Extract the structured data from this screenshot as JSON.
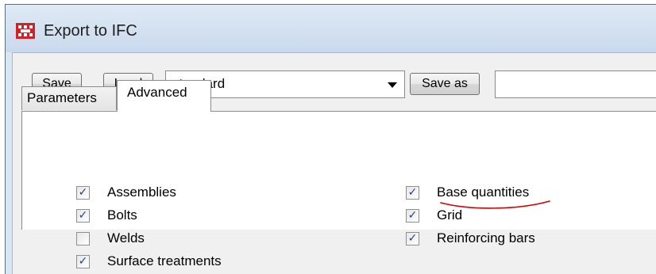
{
  "window": {
    "title": "Export to IFC",
    "icon": "tekla-app-icon",
    "colors": {
      "titlebar": "#d9e6f3",
      "client": "#f0f0f0",
      "check": "#2a3d8f",
      "annotation": "#d60000"
    }
  },
  "toolbar": {
    "save_label": "Save",
    "load_label": "Load",
    "settings_value": "standard",
    "save_as_label": "Save as",
    "save_as_name_value": ""
  },
  "tabs": {
    "parameters_label": "Parameters",
    "advanced_label": "Advanced",
    "active": "Advanced"
  },
  "advanced": {
    "left_options": [
      {
        "label": "Assemblies",
        "checked": true
      },
      {
        "label": "Bolts",
        "checked": true
      },
      {
        "label": "Welds",
        "checked": false
      },
      {
        "label": "Surface treatments",
        "checked": true
      }
    ],
    "right_options": [
      {
        "label": "Base quantities",
        "checked": true
      },
      {
        "label": "Grid",
        "checked": true
      },
      {
        "label": "Reinforcing bars",
        "checked": true
      }
    ]
  },
  "annotation": {
    "type": "red-underline",
    "target": "Base quantities"
  }
}
